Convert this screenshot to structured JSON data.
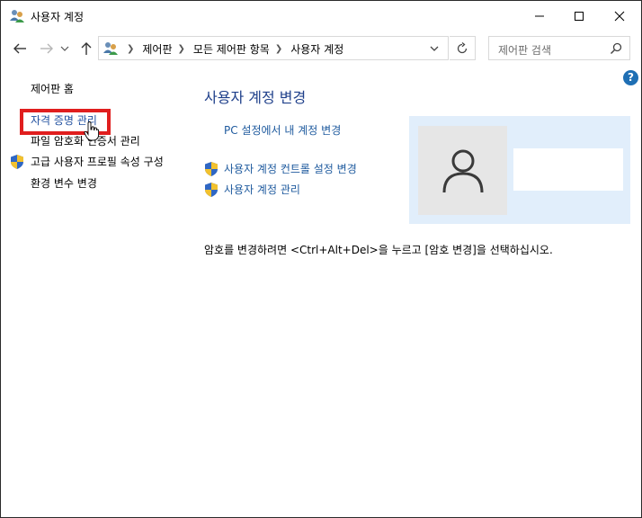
{
  "window": {
    "title": "사용자 계정",
    "icon": "user-accounts-icon"
  },
  "address": {
    "breadcrumbs": [
      "제어판",
      "모든 제어판 항목",
      "사용자 계정"
    ],
    "search_placeholder": "제어판 검색"
  },
  "help": {
    "label": "?"
  },
  "left_pane": {
    "home": "제어판 홈",
    "credential_manager": "자격 증명 관리",
    "file_encryption": "파일 암호화 인증서 관리",
    "advanced_profile": "고급 사용자 프로필 속성 구성",
    "env_vars": "환경 변수 변경"
  },
  "main": {
    "title": "사용자 계정 변경",
    "pc_settings_link": "PC 설정에서 내 계정 변경",
    "uac_link": "사용자 계정 컨트롤 설정 변경",
    "manage_link": "사용자 계정 관리",
    "password_note": "암호를 변경하려면 <Ctrl+Alt+Del>을 누르고 [암호 변경]을 선택하십시오."
  },
  "colors": {
    "link": "#1e5a9e",
    "title": "#1e3f8a",
    "highlight": "#e01e1e",
    "user_panel_bg": "#e1eefb"
  }
}
